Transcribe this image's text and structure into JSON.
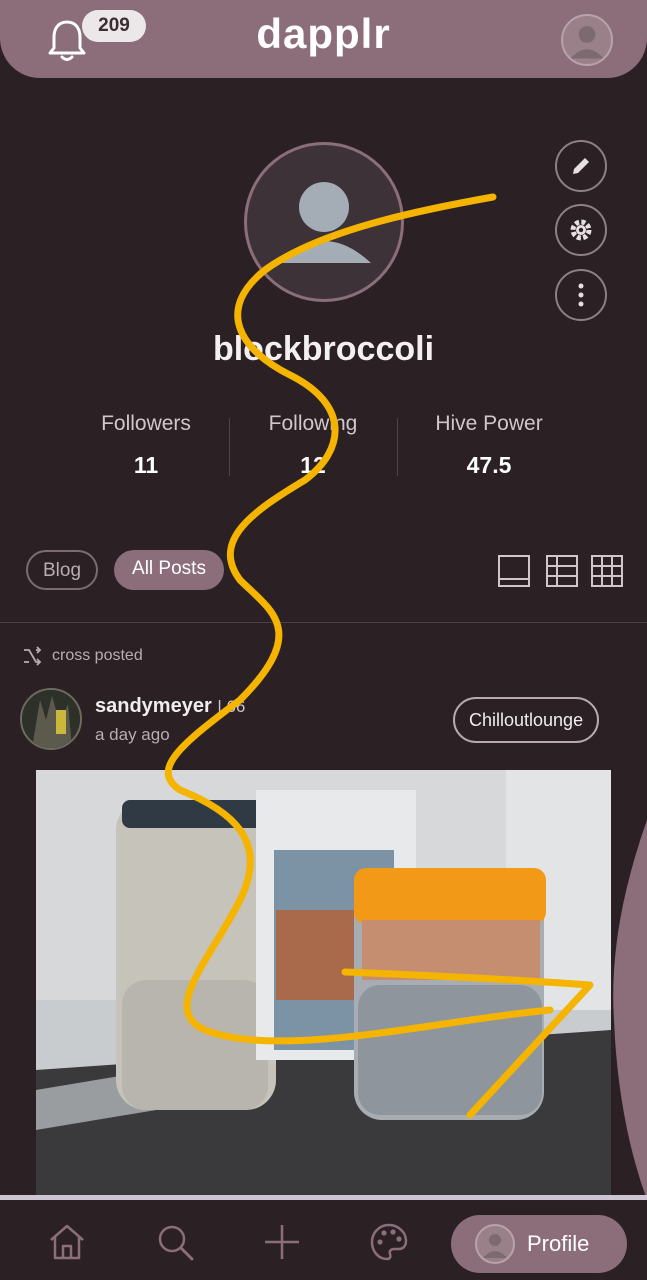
{
  "header": {
    "logo": "dapplr",
    "notification_count": "209"
  },
  "profile": {
    "username": "blockbroccoli",
    "stats": [
      {
        "label": "Followers",
        "value": "11"
      },
      {
        "label": "Following",
        "value": "12"
      },
      {
        "label": "Hive Power",
        "value": "47.5"
      }
    ],
    "tabs": [
      "Blog",
      "All Posts"
    ],
    "active_tab": "All Posts"
  },
  "post": {
    "crosspost_label": "cross posted",
    "author": "sandymeyer",
    "reputation": "66",
    "time": "a day ago",
    "community": "Chilloutlounge"
  },
  "bottom_nav": {
    "items": [
      "home-icon",
      "search-icon",
      "add-icon",
      "palette-icon"
    ],
    "profile_label": "Profile"
  },
  "colors": {
    "background": "#2b2125",
    "accent": "#8b6e7a",
    "scribble": "#f4b400"
  }
}
